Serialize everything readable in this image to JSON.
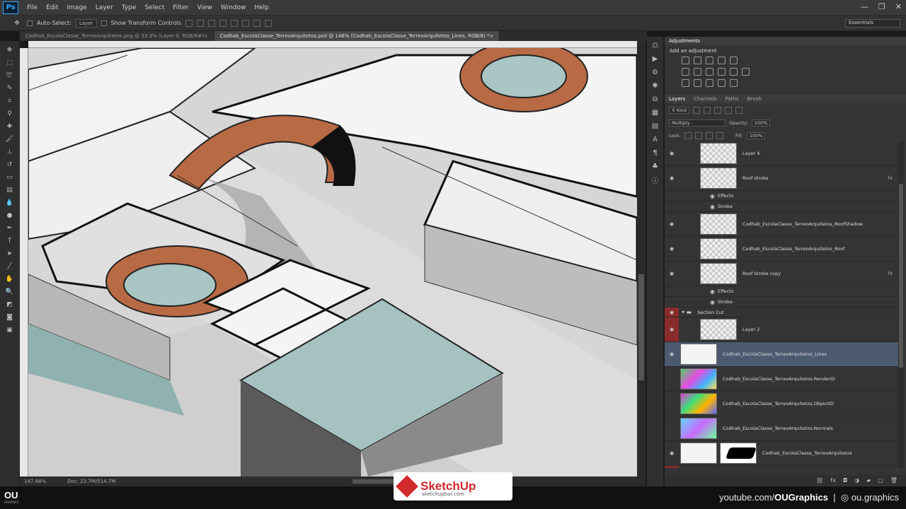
{
  "menu": {
    "logo": "Ps",
    "items": [
      "File",
      "Edit",
      "Image",
      "Layer",
      "Type",
      "Select",
      "Filter",
      "View",
      "Window",
      "Help"
    ]
  },
  "options": {
    "auto_select": "Auto-Select:",
    "target": "Layer",
    "transform": "Show Transform Controls",
    "workspace": "Essentials"
  },
  "tabs": [
    {
      "label": "Codhab_EscolaClasse_TerreoArquitetos.png @ 33.3% (Layer 0, RGB/8#)",
      "active": false
    },
    {
      "label": "Codhab_EscolaClasse_TerreoArquitetos.psd @ 148% (Codhab_EscolaClasse_TerreoArquitetos_Lines, RGB/8) *",
      "active": true
    }
  ],
  "status": {
    "zoom": "147.88%",
    "doc": "Doc: 23.7M/514.7M"
  },
  "adjustments": {
    "tab": "Adjustments",
    "title": "Add an adjustment"
  },
  "layers_panel": {
    "tabs": [
      "Layers",
      "Channels",
      "Paths",
      "Brush"
    ],
    "kind": "Kind",
    "blend": "Multiply",
    "opacity_label": "Opacity:",
    "opacity": "100%",
    "lock_label": "Lock:",
    "fill_label": "Fill:",
    "fill": "100%",
    "layers": [
      {
        "name": "Layer 4",
        "type": "normal"
      },
      {
        "name": "Roof stroke",
        "type": "normal",
        "fx": "fx"
      },
      {
        "name": "Effects",
        "type": "sub"
      },
      {
        "name": "Stroke",
        "type": "sub"
      },
      {
        "name": "Codhab_EscolaClasse_TerreoArquitetos_RoofShadow",
        "type": "normal"
      },
      {
        "name": "Codhab_EscolaClasse_TerreoArquitetos_Roof",
        "type": "normal"
      },
      {
        "name": "Roof stroke copy",
        "type": "normal",
        "fx": "fx"
      },
      {
        "name": "Effects",
        "type": "sub"
      },
      {
        "name": "Stroke",
        "type": "sub"
      },
      {
        "name": "Section Cut",
        "type": "group"
      },
      {
        "name": "Layer 2",
        "type": "normal"
      },
      {
        "name": "Codhab_EscolaClasse_TerreoArquitetos_Lines",
        "type": "selected"
      },
      {
        "name": "Codhab_EscolaClasse_TerreoArquitetos.RenderID",
        "type": "render"
      },
      {
        "name": "Codhab_EscolaClasse_TerreoArquitetos.ObjectID",
        "type": "obj"
      },
      {
        "name": "Codhab_EscolaClasse_TerreoArquitetos.Normals",
        "type": "norm"
      },
      {
        "name": "Codhab_EscolaClasse_TerreoArquitetos",
        "type": "masked"
      },
      {
        "name": "V",
        "type": "group"
      }
    ]
  },
  "footer": {
    "ou": "OU",
    "ou_sub": "GRAPHICS",
    "sketchup": "SketchUp",
    "sketchup_sub": "sketchupbar.com",
    "youtube_prefix": "youtube.com/",
    "youtube_channel": "OUGraphics",
    "instagram": "ou.graphics"
  }
}
